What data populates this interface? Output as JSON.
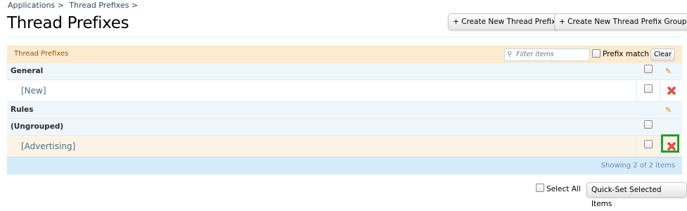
{
  "breadcrumb": [
    {
      "label": "Applications >"
    },
    {
      "label": "Thread Prefixes >"
    }
  ],
  "page_title": "Thread Prefixes",
  "header_buttons": {
    "create_prefix": "+ Create New Thread Prefix",
    "create_group": "+ Create New Thread Prefix Group"
  },
  "panel": {
    "title": "Thread Prefixes",
    "filter_placeholder": "Filter items",
    "prefix_match_label": "Prefix match",
    "clear_label": "Clear"
  },
  "rows": {
    "general": "General",
    "new": "[New]",
    "rules": "Rules",
    "ungrouped": "(Ungrouped)",
    "advertising": "[Advertising]"
  },
  "footer": {
    "showing": "Showing 2 of 2 items",
    "select_all": "Select All",
    "quick_set": "Quick-Set Selected Items"
  },
  "icons": {
    "edit": "pencil-icon",
    "delete": "delete-x-icon",
    "filter": "search-icon"
  },
  "colors": {
    "header_bg": "#fcebcf",
    "group_bg": "#f0f7fc",
    "footer_bg": "#d4ebfa",
    "link": "#4a6d8a",
    "focus": "#1ea02e",
    "delete": "#d8231f"
  }
}
